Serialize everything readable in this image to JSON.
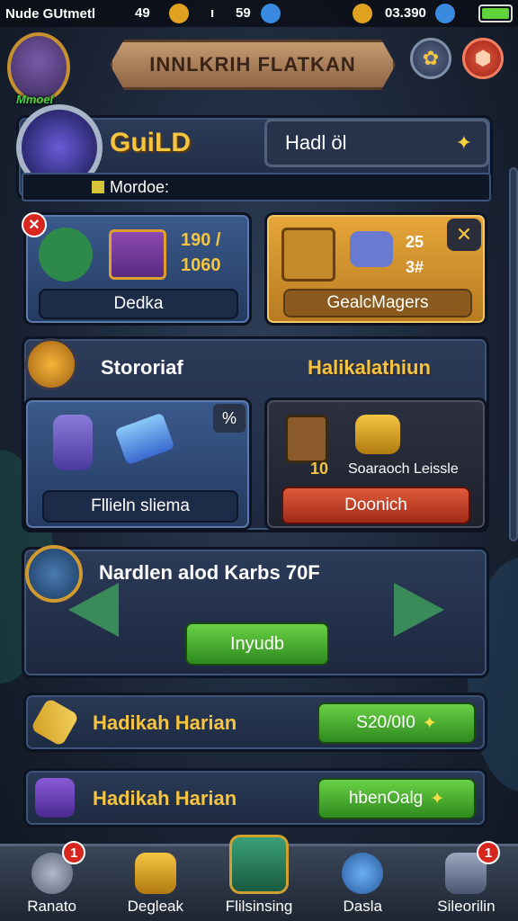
{
  "status": {
    "time": "Nude GUtmetl",
    "stat1": "49",
    "stat2": "59",
    "gems": "03.390"
  },
  "header": {
    "player_level": "Mmoel",
    "banner": "INNLKRIH FLATKAN"
  },
  "guild": {
    "title": "GuiLD",
    "selected": "Hadl öl",
    "member_label": "Mordoe:"
  },
  "cards": {
    "left": {
      "count": "190 /\n1060",
      "button": "Dedka"
    },
    "right": {
      "count": "25\n3#",
      "button": "GealcMagers"
    }
  },
  "section2": {
    "title_left": "Stororiaf",
    "title_right": "Halikalathiun"
  },
  "cards2": {
    "left": {
      "badge": "%",
      "button": "Fllieln sliema"
    },
    "right": {
      "count": "10",
      "label": "Soaraoch Leissle",
      "button": "Doonich"
    }
  },
  "quest": {
    "title": "Nardlen alod Karbs 70F",
    "button": "Inyudb"
  },
  "rows": [
    {
      "label": "Hadikah Harian",
      "button": "S20/0I0"
    },
    {
      "label": "Hadikah Harian",
      "button": "hbenOalg"
    }
  ],
  "nav": [
    {
      "label": "Ranato",
      "badge": "1"
    },
    {
      "label": "Degleak",
      "badge": ""
    },
    {
      "label": "Flilsinsing",
      "badge": ""
    },
    {
      "label": "Dasla",
      "badge": ""
    },
    {
      "label": "Sileorilin",
      "badge": "1"
    }
  ],
  "colors": {
    "accent": "#f5c542",
    "green": "#4caf34",
    "red": "#d6261e",
    "panel": "#243a60"
  }
}
